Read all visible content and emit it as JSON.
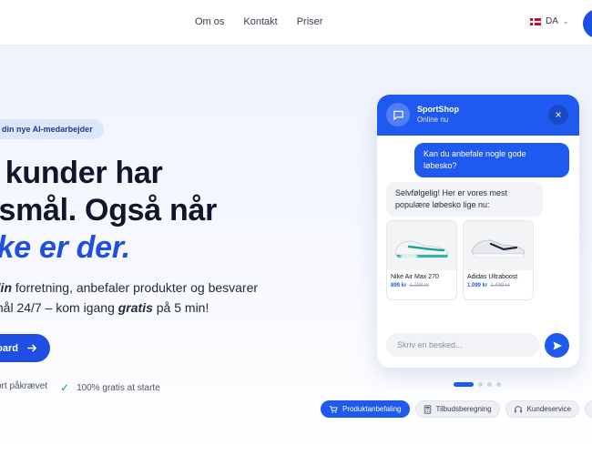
{
  "nav": {
    "items": [
      {
        "label": "Om os"
      },
      {
        "label": "Kontakt"
      },
      {
        "label": "Priser"
      }
    ],
    "language": {
      "code": "DA",
      "flag": "denmark-flag-icon"
    }
  },
  "hero": {
    "badge": "din nye AI-medarbejder",
    "headline": {
      "line1": "e kunder har",
      "line2": "gsmål. Også når",
      "line3_accent": "kke er der."
    },
    "subtext": {
      "line1_bold": "din",
      "line1_rest": " forretning, anbefaler produkter og besvarer",
      "line2_start": "mål 24/7 – kom igang ",
      "line2_bold": "gratis",
      "line2_end": " på 5 min!"
    },
    "primary_button": "board",
    "trust": [
      {
        "label": "ort påkrævet"
      },
      {
        "label": "100% gratis at starte"
      }
    ]
  },
  "chat": {
    "shop_name": "SportShop",
    "status": "Online nu",
    "user_message": "Kan du anbefale nogle gode løbesko?",
    "bot_message": "Selvfølgelig! Her er vores mest populære løbesko lige nu:",
    "products": [
      {
        "name": "Nike Air Max 270",
        "price": "899 kr",
        "old_price": "1.199 kr"
      },
      {
        "name": "Adidas Ultraboost",
        "price": "1.099 kr",
        "old_price": "1.499 kr"
      }
    ],
    "input_placeholder": "Skriv en besked..."
  },
  "carousel": {
    "count": 4,
    "active_index": 0
  },
  "features": [
    {
      "label": "Produktanbefaling",
      "icon": "cart-icon",
      "active": true
    },
    {
      "label": "Tilbudsberegning",
      "icon": "calculator-icon",
      "active": false
    },
    {
      "label": "Kundeservice",
      "icon": "headset-icon",
      "active": false
    },
    {
      "label": "",
      "icon": "sparkle-icon",
      "active": false
    }
  ],
  "colors": {
    "brand_blue": "#1f5af0",
    "headline_accent": "#1f4fe0",
    "success_green": "#16a34a",
    "price_blue": "#1f5af0"
  }
}
